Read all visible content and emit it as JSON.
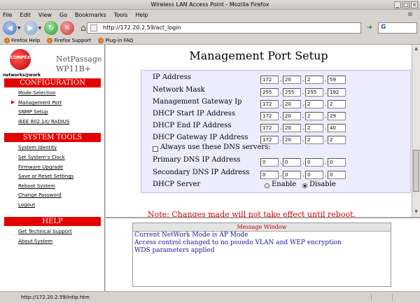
{
  "window": {
    "title": "Wireless LAN Access Point - Mozilla Firefox"
  },
  "menu": [
    "File",
    "Edit",
    "View",
    "Go",
    "Bookmarks",
    "Tools",
    "Help"
  ],
  "url": "http://172.20.2.59/act_login",
  "bookmarks": [
    "Firefox Help",
    "Firefox Support",
    "Plug-in FAQ"
  ],
  "sidebar": {
    "logo": "COMPEX",
    "tagline": "networks@work",
    "product_line1": "NetPassage",
    "product_line2": "WP11B+",
    "sections": [
      {
        "title": "CONFIGURATION",
        "items": [
          "Mode Selection",
          "Management Port",
          "SNMP Setup",
          "IEEE 802.1X/ RADIUS"
        ]
      },
      {
        "title": "SYSTEM TOOLS",
        "items": [
          "System Identity",
          "Set System's Clock",
          "Firmware Upgrade",
          "Save or Reset Settings",
          "Reboot System",
          "Change Password",
          "Logout"
        ]
      },
      {
        "title": "HELP",
        "items": [
          "Get Technical Support",
          "About System"
        ]
      }
    ]
  },
  "main": {
    "title": "Management Port Setup",
    "fields": [
      {
        "label": "IP Address",
        "octets": [
          "172",
          "20",
          "2",
          "59"
        ]
      },
      {
        "label": "Network Mask",
        "octets": [
          "255",
          "255",
          "255",
          "192"
        ]
      },
      {
        "label": "Management Gateway Ip",
        "octets": [
          "172",
          "20",
          "2",
          "2"
        ]
      },
      {
        "label": "DHCP Start IP Address",
        "octets": [
          "172",
          "20",
          "2",
          "29"
        ]
      },
      {
        "label": "DHCP End IP Address",
        "octets": [
          "172",
          "20",
          "2",
          "40"
        ]
      },
      {
        "label": "DHCP Gateway IP Address",
        "octets": [
          "172",
          "20",
          "2",
          "2"
        ]
      }
    ],
    "dns_checkbox_label": "Always use these DNS servers:",
    "dns_fields": [
      {
        "label": "Primary DNS IP Address",
        "octets": [
          "0",
          "0",
          "0",
          "0"
        ]
      },
      {
        "label": "Secondary DNS IP Address",
        "octets": [
          "0",
          "0",
          "0",
          "0"
        ]
      }
    ],
    "dhcp_server_label": "DHCP Server",
    "dhcp_enable_label": "Enable",
    "dhcp_disable_label": "Disable",
    "note_text": "Note: Changes made will not take effect until reboot."
  },
  "message_window": {
    "title": "Message Window",
    "lines": [
      "Current NetWork Mode is AP Mode",
      "Access control changed to no psuedo VLAN and WEP encryption",
      "WDS parameters applied"
    ]
  },
  "status": {
    "text": "http://172.20.2.59/intip.htm"
  }
}
